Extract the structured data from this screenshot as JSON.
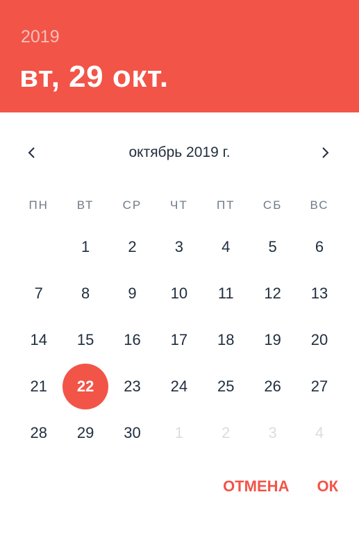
{
  "colors": {
    "accent": "#f25448",
    "text": "#1f2d3d",
    "weekday_text": "#6f7a86",
    "disabled_text": "#d9dde1"
  },
  "header": {
    "year": "2019",
    "selected_date": "вт, 29 окт."
  },
  "navigation": {
    "month_label": "октябрь 2019 г.",
    "prev_icon": "chevron-left-icon",
    "next_icon": "chevron-right-icon"
  },
  "weekdays": [
    "ПН",
    "ВТ",
    "СР",
    "ЧТ",
    "ПТ",
    "СБ",
    "ВС"
  ],
  "weeks": [
    [
      "",
      "1",
      "2",
      "3",
      "4",
      "5",
      "6"
    ],
    [
      "7",
      "8",
      "9",
      "10",
      "11",
      "12",
      "13"
    ],
    [
      "14",
      "15",
      "16",
      "17",
      "18",
      "19",
      "20"
    ],
    [
      "21",
      "22",
      "23",
      "24",
      "25",
      "26",
      "27"
    ],
    [
      "28",
      "29",
      "30",
      "1",
      "2",
      "3",
      "4"
    ]
  ],
  "highlighted_day": "22",
  "next_month_days_row": 4,
  "next_month_days_from_col": 3,
  "actions": {
    "cancel_label": "ОТМЕНА",
    "ok_label": "ОК"
  }
}
